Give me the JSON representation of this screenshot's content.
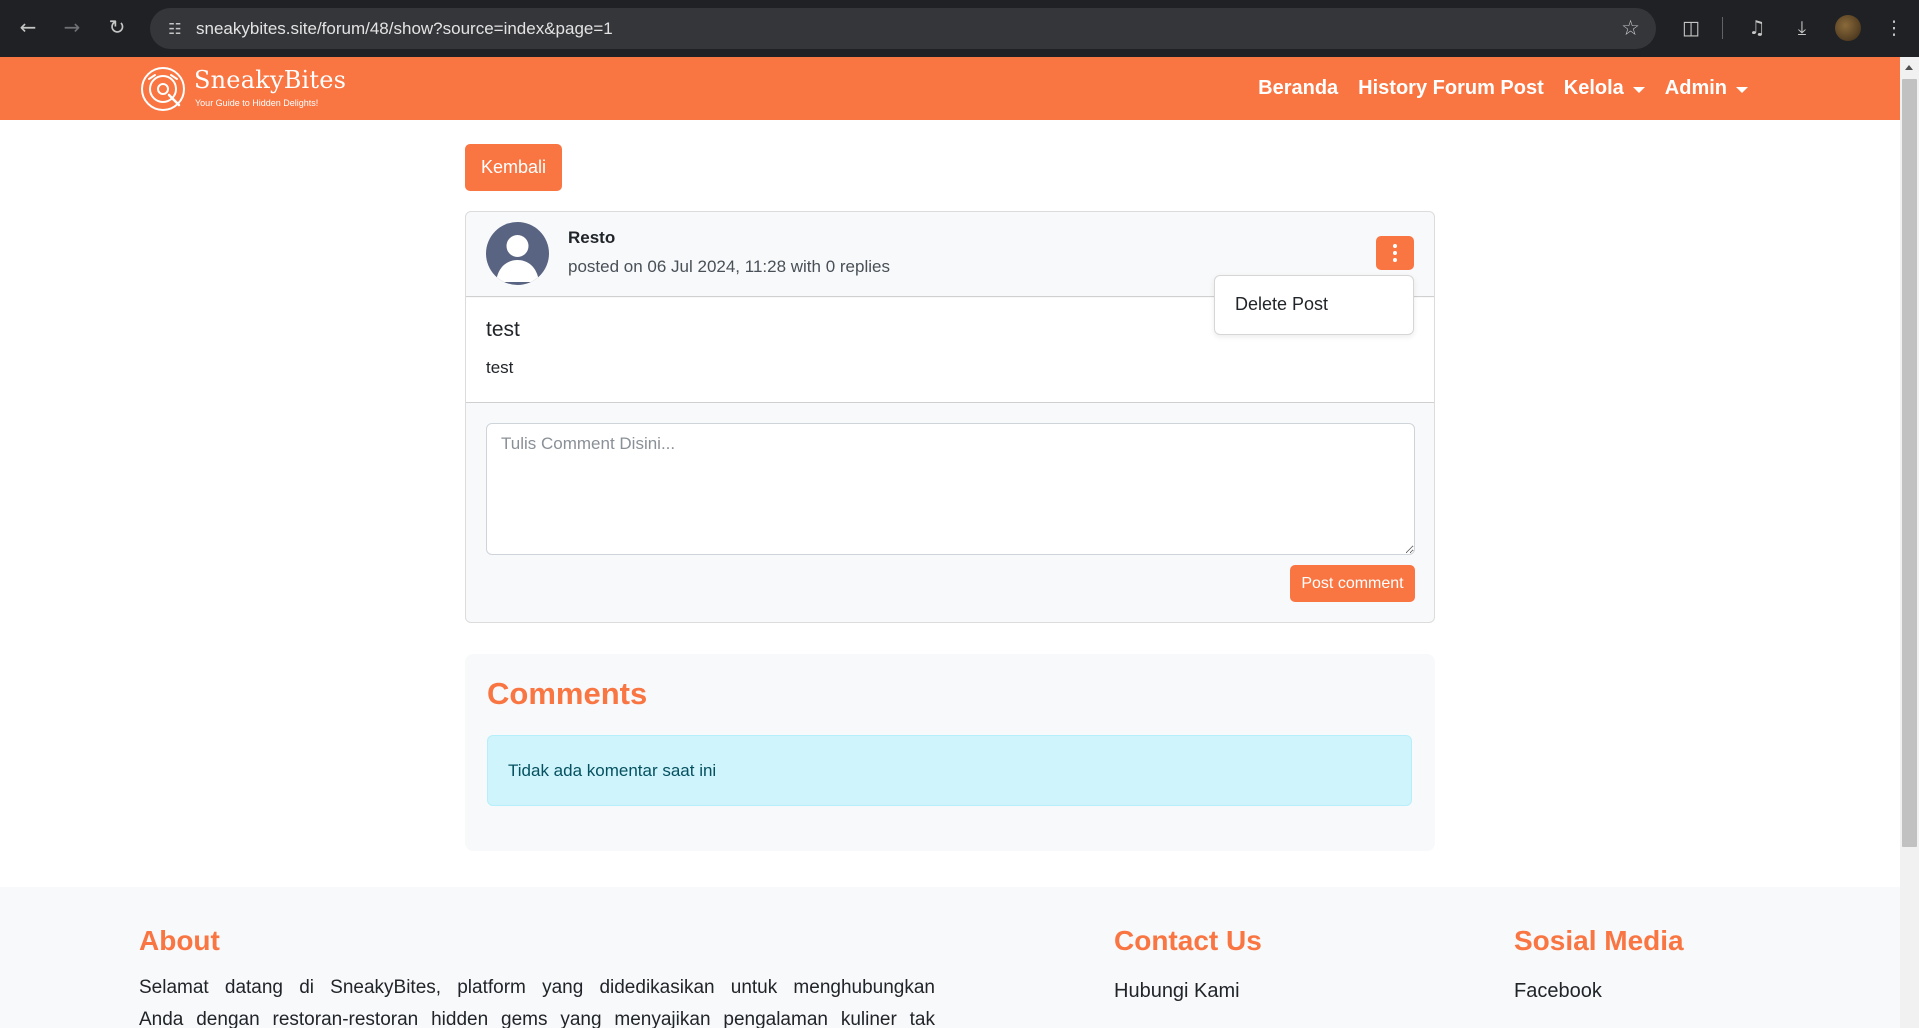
{
  "browser": {
    "url": "sneakybites.site/forum/48/show?source=index&page=1",
    "icons": {
      "back": "arrow-left-icon",
      "forward": "arrow-right-icon",
      "reload": "reload-icon",
      "site_info": "tune-icon",
      "bookmark": "star-icon",
      "extensions": "puzzle-icon",
      "media": "media-queue-icon",
      "downloads": "download-icon",
      "menu": "kebab-icon"
    }
  },
  "navbar": {
    "brand_name": "SneakyBites",
    "brand_tagline": "Your Guide to Hidden Delights!",
    "links": {
      "home": "Beranda",
      "history": "History Forum Post",
      "manage": "Kelola",
      "admin": "Admin"
    },
    "color": "#f97542"
  },
  "page": {
    "back_label": "Kembali"
  },
  "post": {
    "author": "Resto",
    "meta": "posted on 06 Jul 2024, 11:28 with 0 replies",
    "title": "test",
    "content": "test",
    "comment_placeholder": "Tulis Comment Disini...",
    "comment_value": "",
    "submit_label": "Post comment",
    "menu": {
      "delete_label": "Delete Post"
    }
  },
  "comments": {
    "title": "Comments",
    "empty_message": "Tidak ada komentar saat ini"
  },
  "footer": {
    "about": {
      "title": "About",
      "line1": "Selamat datang di SneakyBites, platform yang didedikasikan untuk menghubungkan",
      "line2": "Anda dengan restoran-restoran hidden gems yang menyajikan pengalaman kuliner tak"
    },
    "contact": {
      "title": "Contact Us",
      "link": "Hubungi Kami"
    },
    "social": {
      "title": "Sosial Media",
      "link": "Facebook"
    }
  },
  "colors": {
    "accent": "#f97542",
    "info_bg": "#cff4fc",
    "info_text": "#055160"
  }
}
